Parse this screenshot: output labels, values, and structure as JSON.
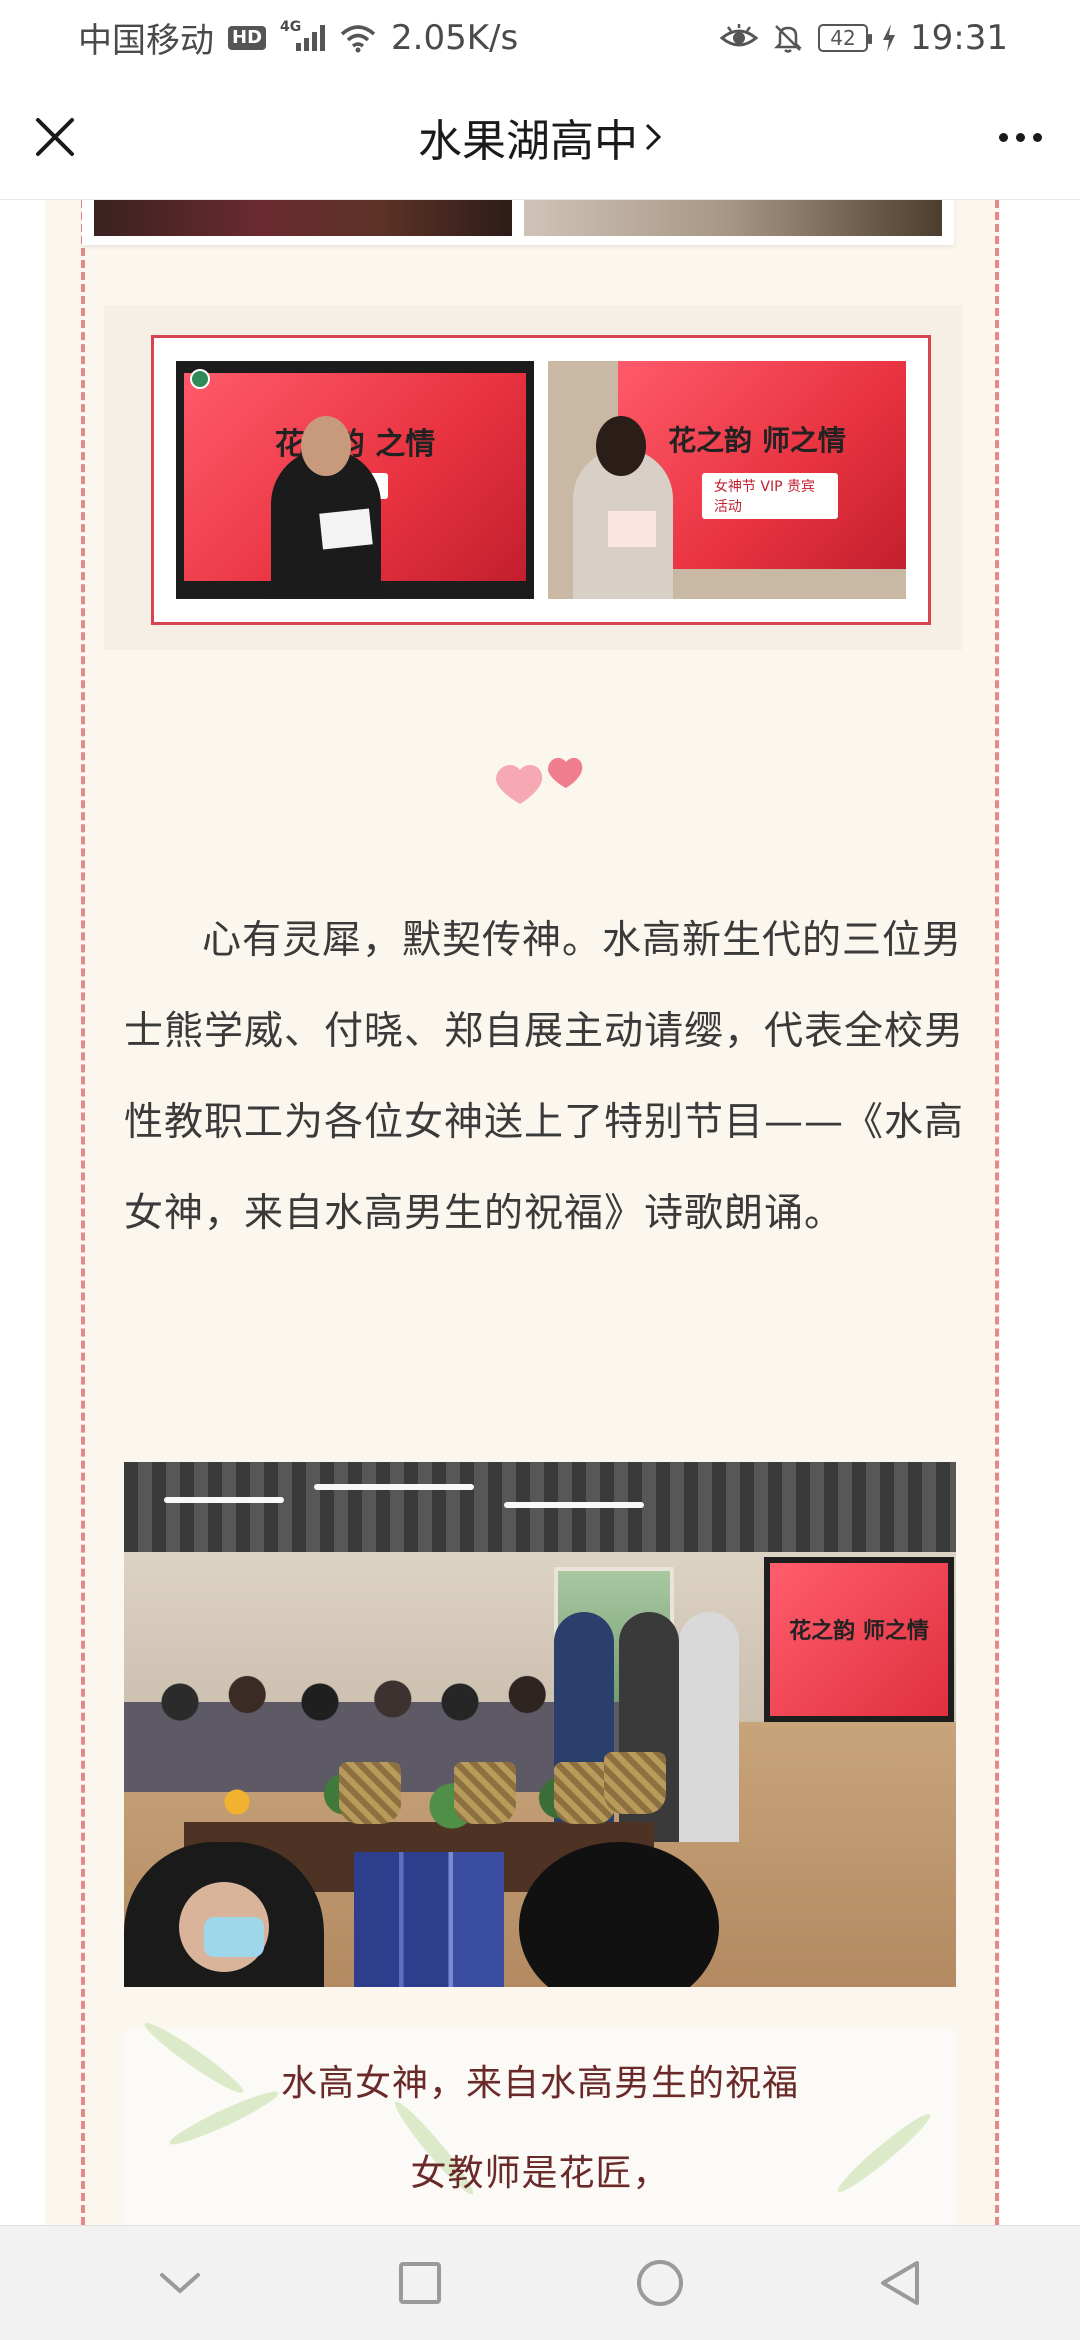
{
  "status_bar": {
    "carrier": "中国移动",
    "hd": "HD",
    "network": "4G",
    "speed": "2.05K/s",
    "battery": "42",
    "time": "19:31"
  },
  "nav": {
    "title": "水果湖高中",
    "title_chevron": "›",
    "close_icon": "close-icon",
    "more_icon": "more-icon"
  },
  "slides": [
    {
      "title": "花之韵 之情",
      "tag": "女神节"
    },
    {
      "title": "花之韵 师之情",
      "tag": "女神节 VIP 贵宾活动"
    }
  ],
  "big_photo_screen_title": "花之韵 师之情",
  "paragraph": "心有灵犀，默契传神。水高新生代的三位男士熊学威、付晓、郑自展主动请缨，代表全校男性教职工为各位女神送上了特别节目——《水高女神，来自水高男生的祝福》诗歌朗诵。",
  "poem": {
    "title": "水高女神，来自水高男生的祝福",
    "line1": "女教师是花匠，"
  },
  "colors": {
    "accent_red": "#d9454f",
    "dash_pink": "#e58a8a",
    "paper_bg": "#fbf6ee",
    "poem_text": "#6b2a2a"
  },
  "system_nav": [
    "collapse-icon",
    "recents-icon",
    "home-icon",
    "back-icon"
  ]
}
